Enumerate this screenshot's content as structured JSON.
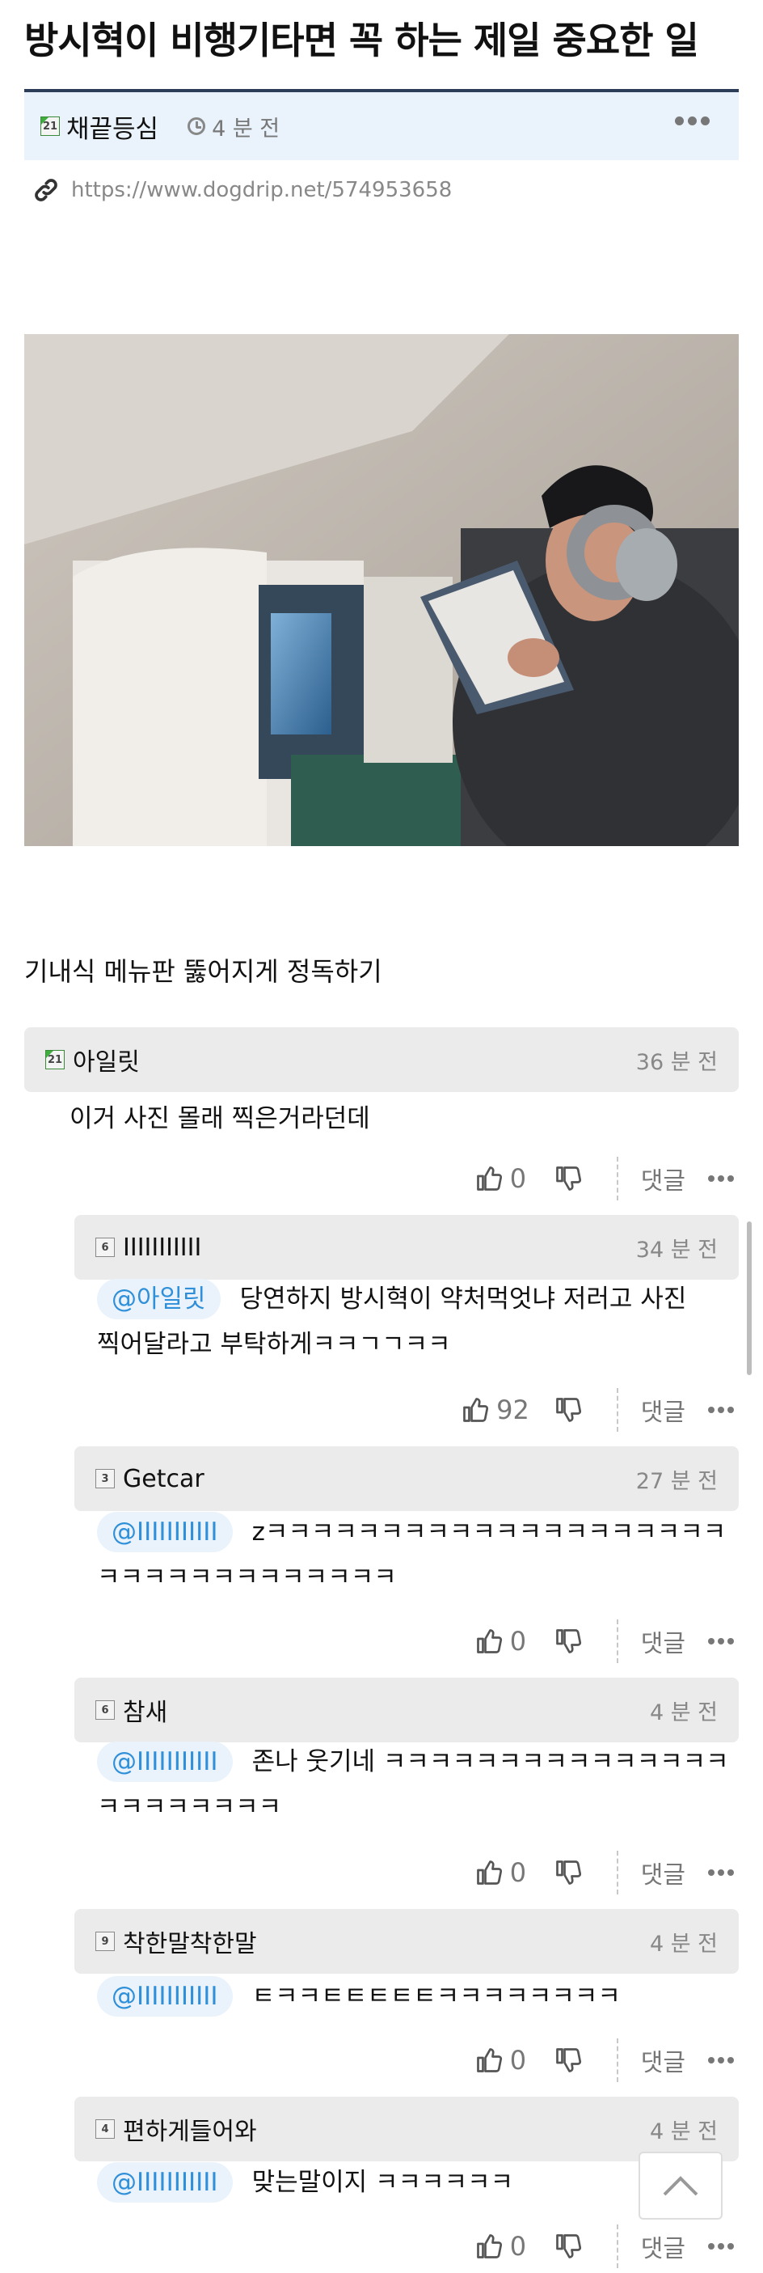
{
  "post": {
    "title": "방시혁이 비행기타면 꼭 하는 제일 중요한 일",
    "author": "채끝등심",
    "author_level": "21",
    "time": "4 분 전",
    "url": "https://www.dogdrip.net/574953658",
    "body": "기내식 메뉴판 뚫어지게 정독하기"
  },
  "icons": {
    "meta": [
      "level-badge-icon",
      "clock-icon",
      "more-dots-icon",
      "link-icon"
    ],
    "comment_actions": [
      "thumbs-up-icon",
      "thumbs-down-icon",
      "more-dots-icon"
    ],
    "scroll_top": "chevron-up-icon"
  },
  "colors": {
    "title_rule": "#2c3e57",
    "meta_bar": "#eaf3fc",
    "comment_header": "#ebebeb",
    "mention_text": "#2f8fd8"
  },
  "actions": {
    "reply_label": "댓글"
  },
  "comments": [
    {
      "author": "아일릿",
      "level": "21",
      "time": "36 분 전",
      "mention": "",
      "lines": [
        "이거 사진 몰래 찍은거라던데"
      ],
      "likes": "0"
    },
    {
      "author": "IIIIIIIIIII",
      "level": "6",
      "time": "34 분 전",
      "mention": "@아일릿",
      "lines": [
        "당연하지 방시혁이 약처먹엇냐 저러고 사진",
        "찍어달라고 부탁하게ㅋㅋㄱㄱㅋㅋ"
      ],
      "likes": "92"
    },
    {
      "author": "Getcar",
      "level": "3",
      "time": "27 분 전",
      "mention": "@IIIIIIIIIII",
      "lines": [
        "zㅋㅋㅋㅋㅋㅋㅋㅋㅋㅋㅋㅋㅋㅋㅋㅋㅋㅋㅋㅋ",
        "ㅋㅋㅋㅋㅋㅋㅋㅋㅋㅋㅋㅋㅋ"
      ],
      "likes": "0"
    },
    {
      "author": "참새",
      "level": "6",
      "time": "4 분 전",
      "mention": "@IIIIIIIIIII",
      "lines": [
        "존나 웃기네 ㅋㅋㅋㅋㅋㅋㅋㅋㅋㅋㅋㅋㅋㅋㅋ",
        "ㅋㅋㅋㅋㅋㅋㅋㅋ"
      ],
      "likes": "0"
    },
    {
      "author": "착한말착한말",
      "level": "9",
      "time": "4 분 전",
      "mention": "@IIIIIIIIIII",
      "lines": [
        "ㅌㅋㅋㅌㅌㅌㅌㅌㅋㅋㅋㅋㅋㅋㅋㅋ"
      ],
      "likes": "0"
    },
    {
      "author": "편하게들어와",
      "level": "4",
      "time": "4 분 전",
      "mention": "@IIIIIIIIIII",
      "lines": [
        "맞는말이지 ㅋㅋㅋㅋㅋㅋ"
      ],
      "likes": "0"
    }
  ]
}
